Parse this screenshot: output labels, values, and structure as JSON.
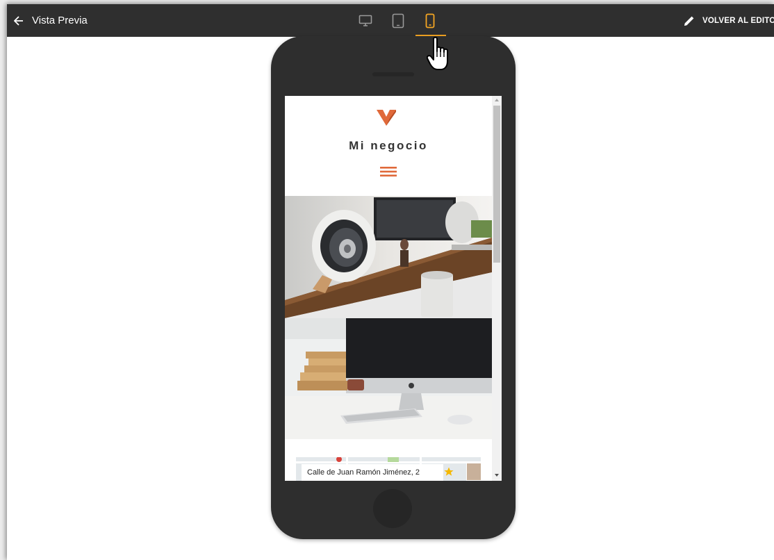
{
  "topbar": {
    "back_label": "Vista Previa",
    "editor_label": "VOLVER AL EDITOR",
    "devices": [
      {
        "icon": "desktop-icon",
        "active": false
      },
      {
        "icon": "tablet-icon",
        "active": false
      },
      {
        "icon": "mobile-icon",
        "active": true
      }
    ]
  },
  "site": {
    "title": "Mi negocio",
    "address": "Calle de Juan Ramón Jiménez, 2"
  },
  "colors": {
    "topbar_bg": "#2f2f2f",
    "accent": "#f5a623",
    "brand": "#e0693a",
    "phone_body": "#2e2e2e"
  }
}
